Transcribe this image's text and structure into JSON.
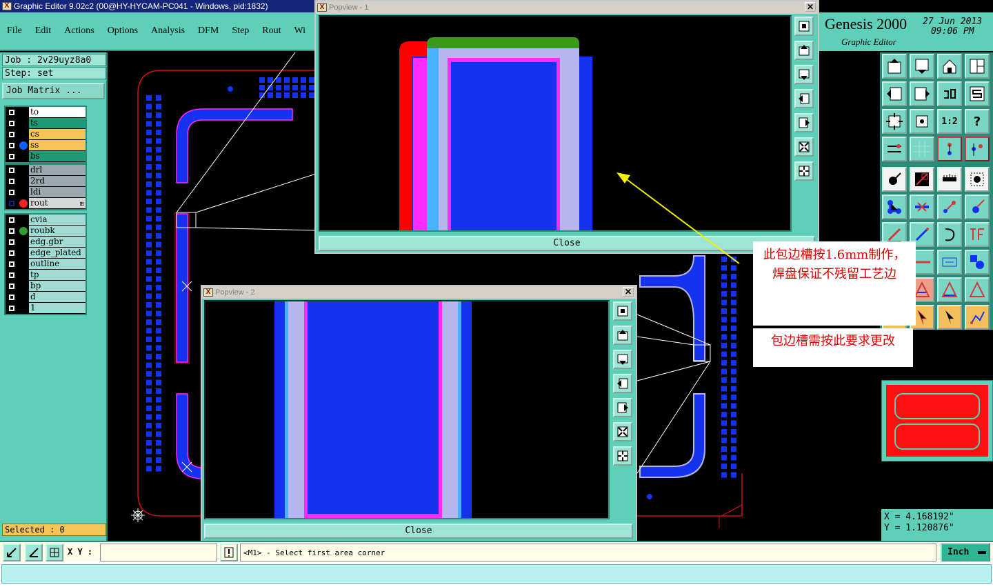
{
  "window": {
    "title": "Graphic Editor 9.02c2 (00@HY-HYCAM-PC041 - Windows, pid:1832)"
  },
  "menu": [
    {
      "label": "File"
    },
    {
      "label": "Edit"
    },
    {
      "label": "Actions"
    },
    {
      "label": "Options"
    },
    {
      "label": "Analysis"
    },
    {
      "label": "DFM"
    },
    {
      "label": "Step"
    },
    {
      "label": "Rout"
    },
    {
      "label": "Wi"
    }
  ],
  "job": {
    "job_label": "Job : 2v29uyz8a0",
    "step_label": "Step: set",
    "matrix_button": "Job Matrix ..."
  },
  "layer_groups": [
    [
      {
        "name": "to",
        "color": "#ffffff",
        "dot": ""
      },
      {
        "name": "ts",
        "color": "#1e9a78",
        "dot": ""
      },
      {
        "name": "cs",
        "color": "#f5c656",
        "dot": ""
      },
      {
        "name": "ss",
        "color": "#f5c656",
        "dot": "#1060ff"
      },
      {
        "name": "bs",
        "color": "#1e9a78",
        "dot": ""
      }
    ],
    [
      {
        "name": "drl",
        "color": "#9aa8b0",
        "dot": ""
      },
      {
        "name": "2rd",
        "color": "#9aa8b0",
        "dot": ""
      },
      {
        "name": "ldi",
        "color": "#9aa8b0",
        "dot": ""
      },
      {
        "name": "rout",
        "color": "#d8d8d8",
        "dot": "#ff2020",
        "active": true
      }
    ],
    [
      {
        "name": "cvia",
        "color": "#a0dcd4",
        "dot": ""
      },
      {
        "name": "roubk",
        "color": "#a0dcd4",
        "dot": "#30a030"
      },
      {
        "name": "edg.gbr",
        "color": "#a0dcd4",
        "dot": ""
      },
      {
        "name": "edge_plated",
        "color": "#a0dcd4",
        "dot": ""
      },
      {
        "name": "outline",
        "color": "#a0dcd4",
        "dot": ""
      },
      {
        "name": "tp",
        "color": "#a0dcd4",
        "dot": ""
      },
      {
        "name": "bp",
        "color": "#a0dcd4",
        "dot": ""
      },
      {
        "name": "d",
        "color": "#a0dcd4",
        "dot": ""
      },
      {
        "name": "1",
        "color": "#a0dcd4",
        "dot": ""
      }
    ]
  ],
  "selected": "Selected : 0",
  "popview1": {
    "title": "Popview - 1",
    "close_label": "Close"
  },
  "popview2": {
    "title": "Popview - 2",
    "close_label": "Close"
  },
  "genesis": {
    "brand": "Genesis 2000",
    "date": "27 Jun 2013",
    "time": "09:06 PM",
    "subtitle": "Graphic Editor"
  },
  "annotations": {
    "note1": "此包边槽按1.6mm制作，焊盘保证不残留工艺边",
    "note2": "包边槽需按此要求更改"
  },
  "coords": {
    "x": "X  =  4.168192\"",
    "y": "Y  =  1.120876\""
  },
  "bottom": {
    "xy_label": "X Y :",
    "xy_value": "",
    "prompt": "<M1> - Select first area corner",
    "unit": "Inch"
  },
  "tool_button_text": {
    "scale_1_2": "1:2",
    "help": "?"
  },
  "colors": {
    "panel": "#5ecfb8",
    "accent_dark": "#2c8a78",
    "title_blue": "#15257a",
    "feature_blue": "#1432f0",
    "feature_lavender": "#b8b4ee",
    "feature_magenta": "#ff2aff",
    "feature_red": "#ff0000",
    "annotation_red": "#e00000",
    "arrow_yellow": "#f5f000"
  }
}
